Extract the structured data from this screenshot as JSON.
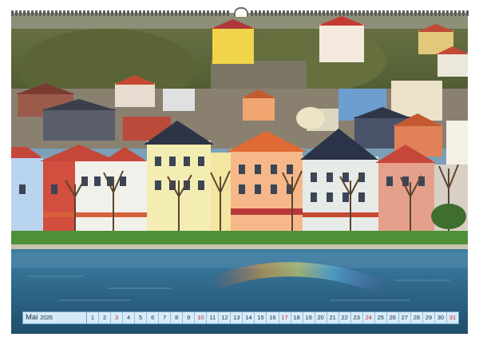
{
  "calendar": {
    "month": "Mai",
    "year": "2026",
    "days": [
      "1",
      "2",
      "3",
      "4",
      "5",
      "6",
      "7",
      "8",
      "9",
      "10",
      "11",
      "12",
      "13",
      "14",
      "15",
      "16",
      "17",
      "18",
      "19",
      "20",
      "21",
      "22",
      "23",
      "24",
      "25",
      "26",
      "27",
      "28",
      "29",
      "30",
      "31"
    ],
    "sundays": [
      "3",
      "10",
      "17",
      "24",
      "31"
    ]
  },
  "photo": {
    "subject": "harbor-town-scene",
    "colors": {
      "water": "#2f6a8c",
      "hill": "#5c6b3a",
      "grass": "#4f8f38",
      "sky_reflection": "#9cc4dc"
    }
  },
  "binding": {
    "hanger": "wire-hanger-icon"
  }
}
